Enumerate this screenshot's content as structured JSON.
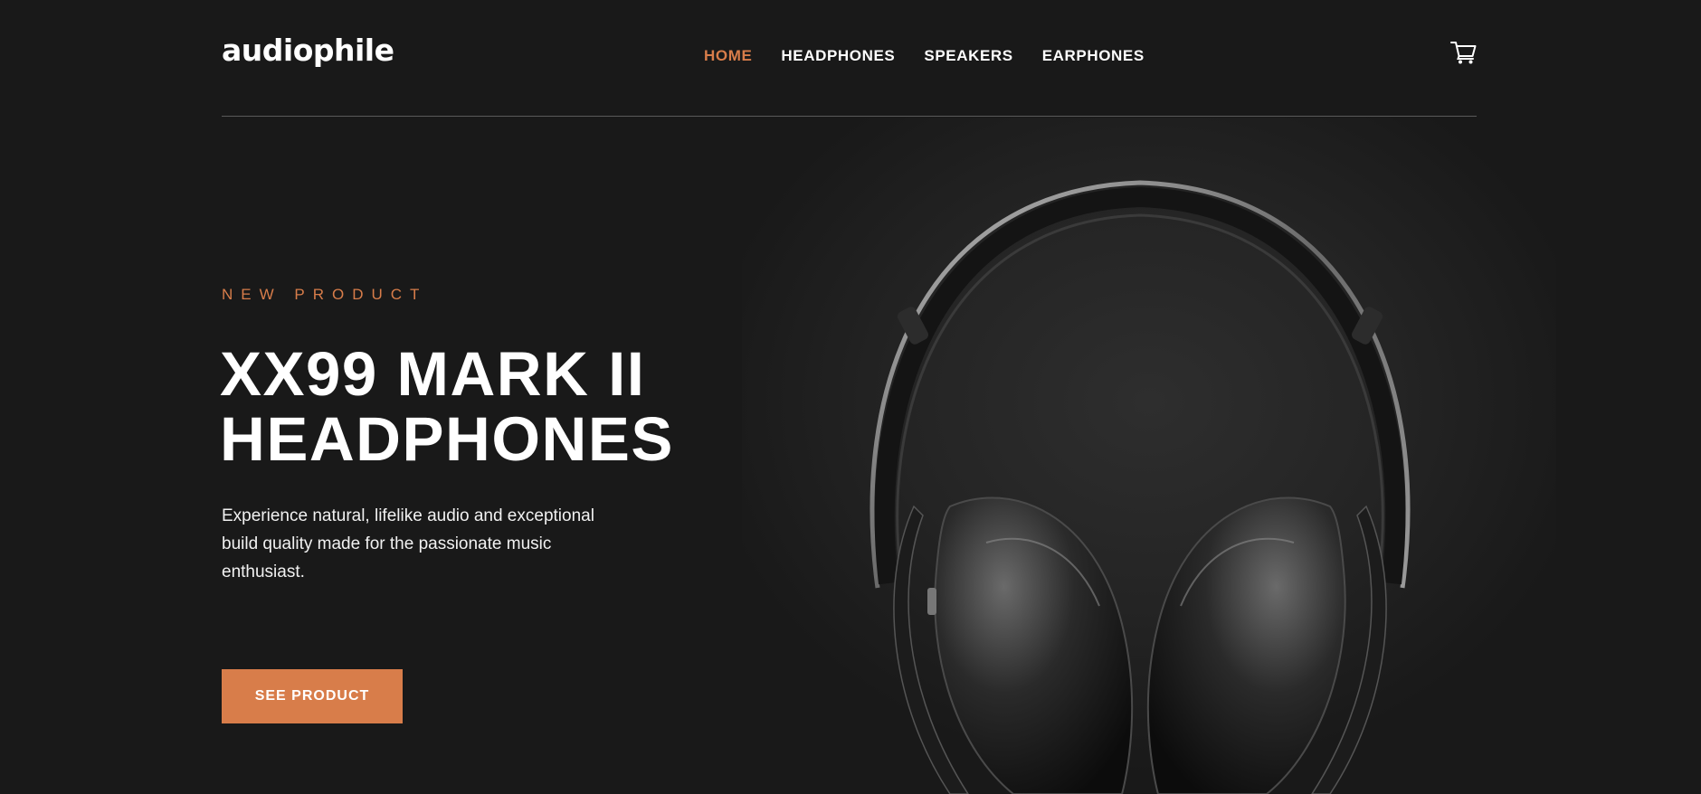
{
  "brand": {
    "logo_text": "audiophile"
  },
  "nav": {
    "items": [
      {
        "label": "HOME",
        "active": true
      },
      {
        "label": "HEADPHONES",
        "active": false
      },
      {
        "label": "SPEAKERS",
        "active": false
      },
      {
        "label": "EARPHONES",
        "active": false
      }
    ],
    "cart_icon": "shopping-cart-icon"
  },
  "hero": {
    "overline": "NEW PRODUCT",
    "title_line_1": "XX99 MARK II",
    "title_line_2": "HEADPHONES",
    "description": "Experience natural, lifelike audio and exceptional build quality made for the passionate music enthusiast.",
    "cta_label": "SEE PRODUCT",
    "image": "over-ear-headphones-image"
  },
  "colors": {
    "background": "#191919",
    "accent": "#D87D4A",
    "text": "#FFFFFF",
    "divider": "#5A5A5A"
  }
}
